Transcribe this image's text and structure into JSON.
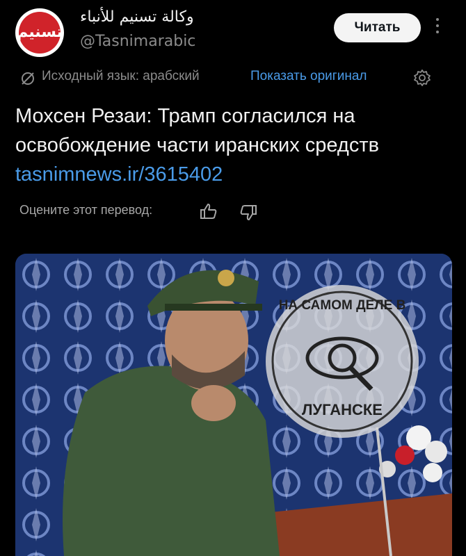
{
  "header": {
    "account_name": "وكالة تسنيم للأنباء",
    "handle": "@Tasnimarabic",
    "follow_label": "Читать",
    "avatar_icon": "tasnim-logo-icon",
    "more_icon": "more-vertical-icon"
  },
  "translation": {
    "source_language_text": "Исходный язык: арабский",
    "show_original_label": "Показать оригинал",
    "translate_icon": "slash-translate-icon",
    "settings_icon": "gear-icon"
  },
  "post": {
    "text": "Мохсен Резаи: Трамп согласился на освобождение части иранских средств",
    "link": "tasnimnews.ir/3615402"
  },
  "rating": {
    "prompt": "Оцените этот перевод:",
    "like_icon": "thumb-up-icon",
    "dislike_icon": "thumb-down-icon"
  },
  "media": {
    "watermark_top": "НА САМОМ ДЕЛЕ В",
    "watermark_bottom": "ЛУГАНСКЕ",
    "colors": {
      "background_blue": "#1a2f66",
      "uniform_green": "#3f5a3a",
      "podium": "#8a3b22"
    }
  },
  "colors": {
    "background": "#000000",
    "link_blue": "#4a9be8",
    "muted_text": "#8b8b8b",
    "button_bg": "#f4f4f4"
  }
}
